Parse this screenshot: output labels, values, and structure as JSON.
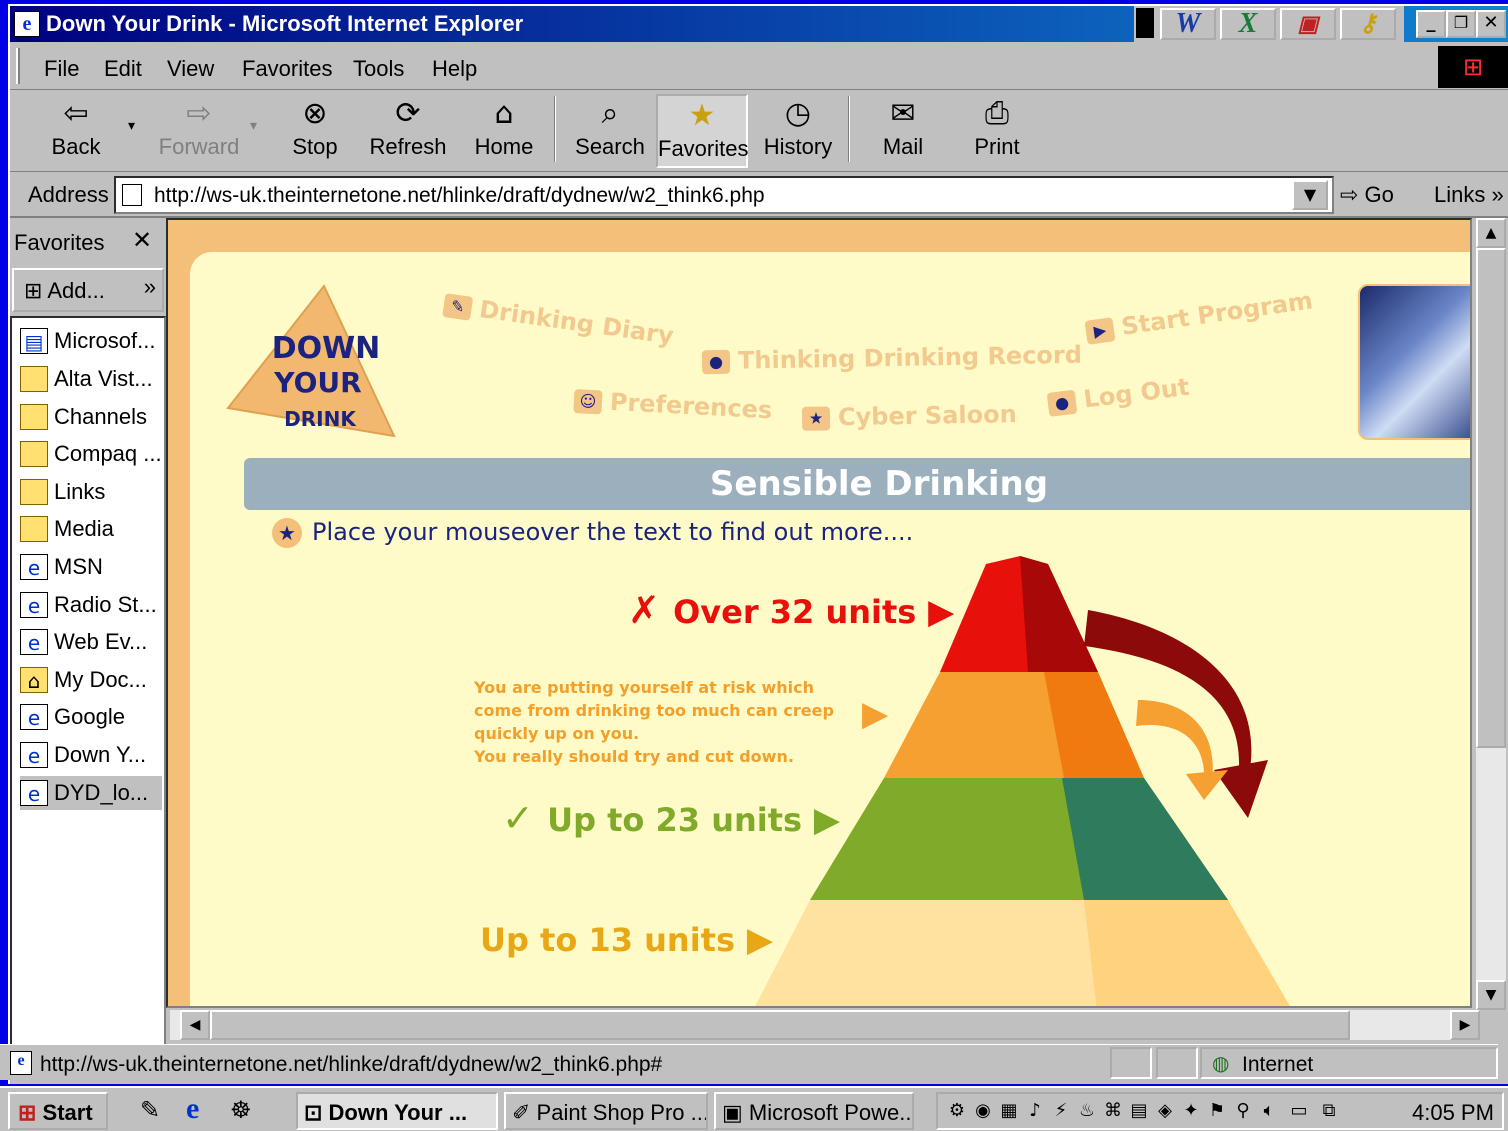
{
  "window": {
    "title": "Down Your Drink - Microsoft Internet Explorer"
  },
  "titlebar_apps": [
    "W",
    "X"
  ],
  "menu": [
    "File",
    "Edit",
    "View",
    "Favorites",
    "Tools",
    "Help"
  ],
  "toolbar": {
    "back": "Back",
    "forward": "Forward",
    "stop": "Stop",
    "refresh": "Refresh",
    "home": "Home",
    "search": "Search",
    "favorites": "Favorites",
    "history": "History",
    "mail": "Mail",
    "print": "Print"
  },
  "address": {
    "label": "Address",
    "url": "http://ws-uk.theinternetone.net/hlinke/draft/dydnew/w2_think6.php",
    "go": "Go",
    "links": "Links"
  },
  "favorites_pane": {
    "title": "Favorites",
    "add": "Add...",
    "items": [
      {
        "label": "Microsof...",
        "icon": "page-icon"
      },
      {
        "label": "Alta Vist...",
        "icon": "folder-icon"
      },
      {
        "label": "Channels",
        "icon": "folder-icon"
      },
      {
        "label": "Compaq ...",
        "icon": "folder-icon"
      },
      {
        "label": "Links",
        "icon": "folder-icon"
      },
      {
        "label": "Media",
        "icon": "folder-icon"
      },
      {
        "label": "MSN",
        "icon": "ie-page-icon"
      },
      {
        "label": "Radio St...",
        "icon": "ie-page-icon"
      },
      {
        "label": "Web Ev...",
        "icon": "ie-page-icon"
      },
      {
        "label": "My Doc...",
        "icon": "folder-icon"
      },
      {
        "label": "Google",
        "icon": "ie-page-icon"
      },
      {
        "label": "Down Y...",
        "icon": "ie-page-icon"
      },
      {
        "label": "DYD_lo...",
        "icon": "ie-page-icon"
      }
    ]
  },
  "site": {
    "logo": [
      "DOWN",
      "YOUR",
      "DRINK"
    ],
    "nav": {
      "drinking_diary": "Drinking Diary",
      "thinking_record": "Thinking Drinking Record",
      "start_program": "Start Program",
      "preferences": "Preferences",
      "cyber_saloon": "Cyber Saloon",
      "log_out": "Log Out"
    },
    "banner": "Sensible Drinking",
    "instruction": "Place your mouseover the text to find out more....",
    "levels": {
      "over32": "Over 32 units",
      "upto23": "Up to 23 units",
      "upto13": "Up to 13 units"
    },
    "risk_text": [
      "You are putting yourself at risk which",
      "come from drinking too much can creep",
      "quickly up on you.",
      "You really should try and cut down."
    ],
    "colors": {
      "red": "#e8100a",
      "orange": "#f5a030",
      "green": "#7faa2a",
      "sand": "#ffe2a0"
    }
  },
  "status": {
    "url": "http://ws-uk.theinternetone.net/hlinke/draft/dydnew/w2_think6.php#",
    "zone": "Internet"
  },
  "taskbar": {
    "start": "Start",
    "tasks": [
      "Down Your ...",
      "Paint Shop Pro ...",
      "Microsoft Powe..."
    ],
    "clock": "4:05 PM"
  }
}
